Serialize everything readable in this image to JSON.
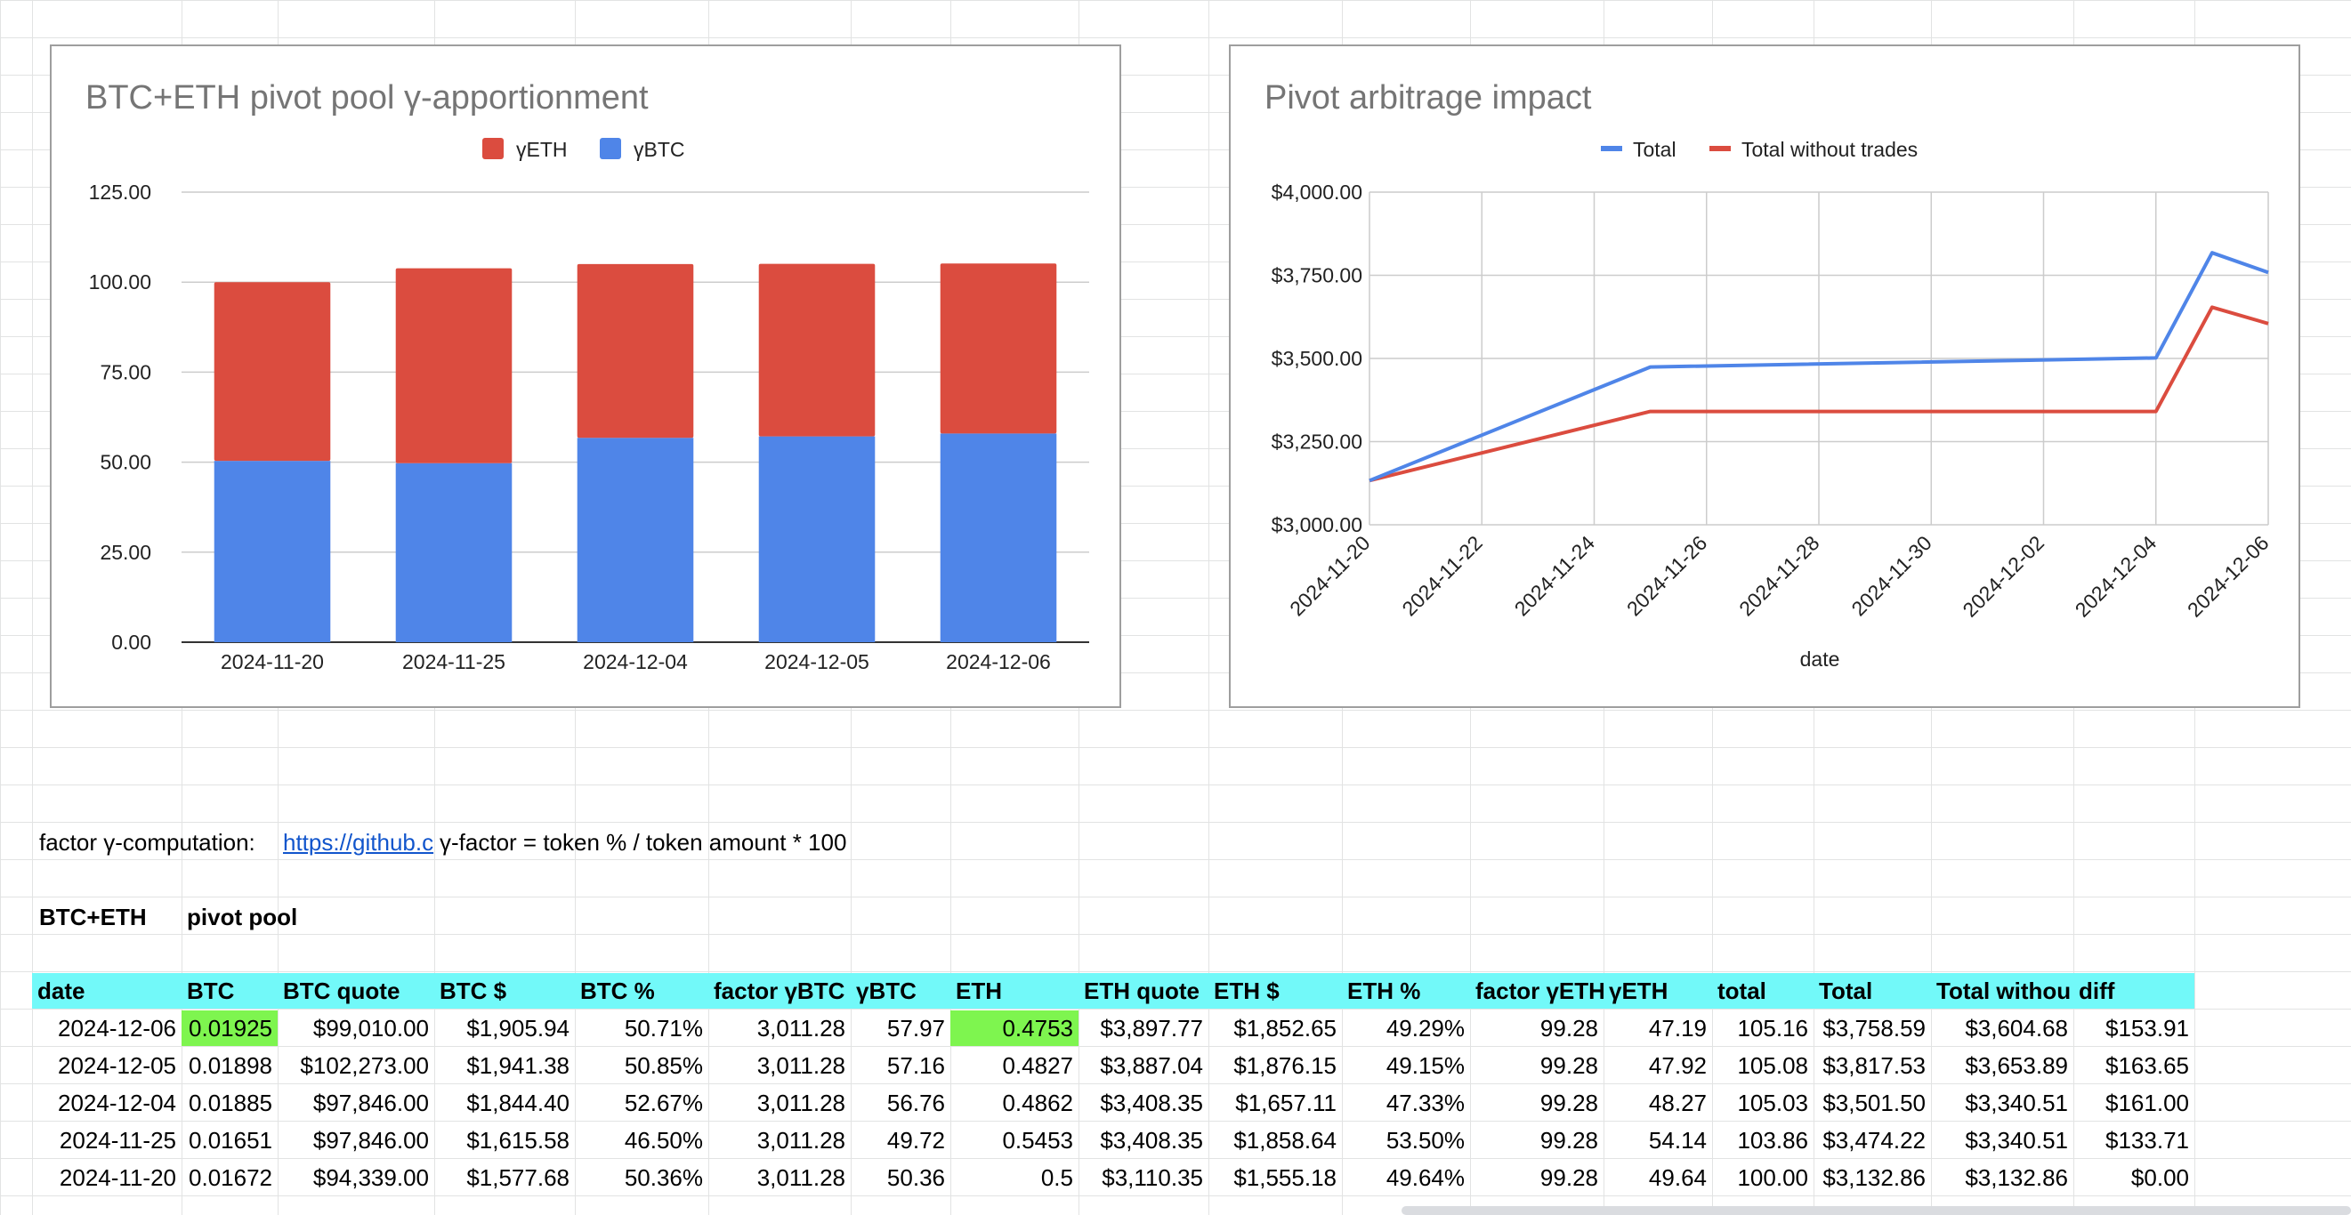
{
  "colors": {
    "eth": "#db4c3f",
    "btc": "#4f85e8",
    "total": "#4f85e8",
    "without": "#db4c3f",
    "header_bg": "#72f9f9",
    "highlight": "#7ef54f"
  },
  "chart_data": [
    {
      "type": "bar",
      "title": "BTC+ETH pivot pool γ-apportionment",
      "categories": [
        "2024-11-20",
        "2024-11-25",
        "2024-12-04",
        "2024-12-05",
        "2024-12-06"
      ],
      "series": [
        {
          "name": "γETH",
          "values": [
            49.64,
            54.14,
            48.27,
            47.92,
            47.19
          ]
        },
        {
          "name": "γBTC",
          "values": [
            50.36,
            49.72,
            56.76,
            57.16,
            57.97
          ]
        }
      ],
      "stacked": true,
      "ylim": [
        0,
        125
      ],
      "yticks": [
        "0.00",
        "25.00",
        "50.00",
        "75.00",
        "100.00",
        "125.00"
      ],
      "legend": "top",
      "grid": true
    },
    {
      "type": "line",
      "title": "Pivot arbitrage impact",
      "xlabel": "date",
      "x": [
        "2024-11-20",
        "2024-11-25",
        "2024-12-04",
        "2024-12-05",
        "2024-12-06"
      ],
      "series": [
        {
          "name": "Total",
          "values": [
            3132.86,
            3474.22,
            3501.5,
            3817.53,
            3758.59
          ]
        },
        {
          "name": "Total without trades",
          "values": [
            3132.86,
            3340.51,
            3340.51,
            3653.89,
            3604.68
          ]
        }
      ],
      "ylim": [
        3000,
        4000
      ],
      "yticks": [
        "$3,000.00",
        "$3,250.00",
        "$3,500.00",
        "$3,750.00",
        "$4,000.00"
      ],
      "xticks": [
        "2024-11-20",
        "2024-11-22",
        "2024-11-24",
        "2024-11-26",
        "2024-11-28",
        "2024-11-30",
        "2024-12-02",
        "2024-12-04",
        "2024-12-06"
      ],
      "legend": "top",
      "grid": true
    }
  ],
  "sheet": {
    "factor_label": "factor γ-computation:",
    "link_text": "https://github.c",
    "formula_note": "γ-factor = token % / token amount * 100",
    "pool_label": "BTC+ETH",
    "pool_type": "pivot pool",
    "columns": [
      "date",
      "BTC",
      "BTC quote",
      "BTC $",
      "BTC %",
      "factor γBTC",
      "γBTC",
      "ETH",
      "ETH quote",
      "ETH $",
      "ETH %",
      "factor γETH",
      "γETH",
      "total",
      "Total",
      "Total withou",
      "diff"
    ],
    "rows": [
      [
        "2024-12-06",
        "0.01925",
        "$99,010.00",
        "$1,905.94",
        "50.71%",
        "3,011.28",
        "57.97",
        "0.4753",
        "$3,897.77",
        "$1,852.65",
        "49.29%",
        "99.28",
        "47.19",
        "105.16",
        "$3,758.59",
        "$3,604.68",
        "$153.91"
      ],
      [
        "2024-12-05",
        "0.01898",
        "$102,273.00",
        "$1,941.38",
        "50.85%",
        "3,011.28",
        "57.16",
        "0.4827",
        "$3,887.04",
        "$1,876.15",
        "49.15%",
        "99.28",
        "47.92",
        "105.08",
        "$3,817.53",
        "$3,653.89",
        "$163.65"
      ],
      [
        "2024-12-04",
        "0.01885",
        "$97,846.00",
        "$1,844.40",
        "52.67%",
        "3,011.28",
        "56.76",
        "0.4862",
        "$3,408.35",
        "$1,657.11",
        "47.33%",
        "99.28",
        "48.27",
        "105.03",
        "$3,501.50",
        "$3,340.51",
        "$161.00"
      ],
      [
        "2024-11-25",
        "0.01651",
        "$97,846.00",
        "$1,615.58",
        "46.50%",
        "3,011.28",
        "49.72",
        "0.5453",
        "$3,408.35",
        "$1,858.64",
        "53.50%",
        "99.28",
        "54.14",
        "103.86",
        "$3,474.22",
        "$3,340.51",
        "$133.71"
      ],
      [
        "2024-11-20",
        "0.01672",
        "$94,339.00",
        "$1,577.68",
        "50.36%",
        "3,011.28",
        "50.36",
        "0.5",
        "$3,110.35",
        "$1,555.18",
        "49.64%",
        "99.28",
        "49.64",
        "100.00",
        "$3,132.86",
        "$3,132.86",
        "$0.00"
      ]
    ]
  }
}
